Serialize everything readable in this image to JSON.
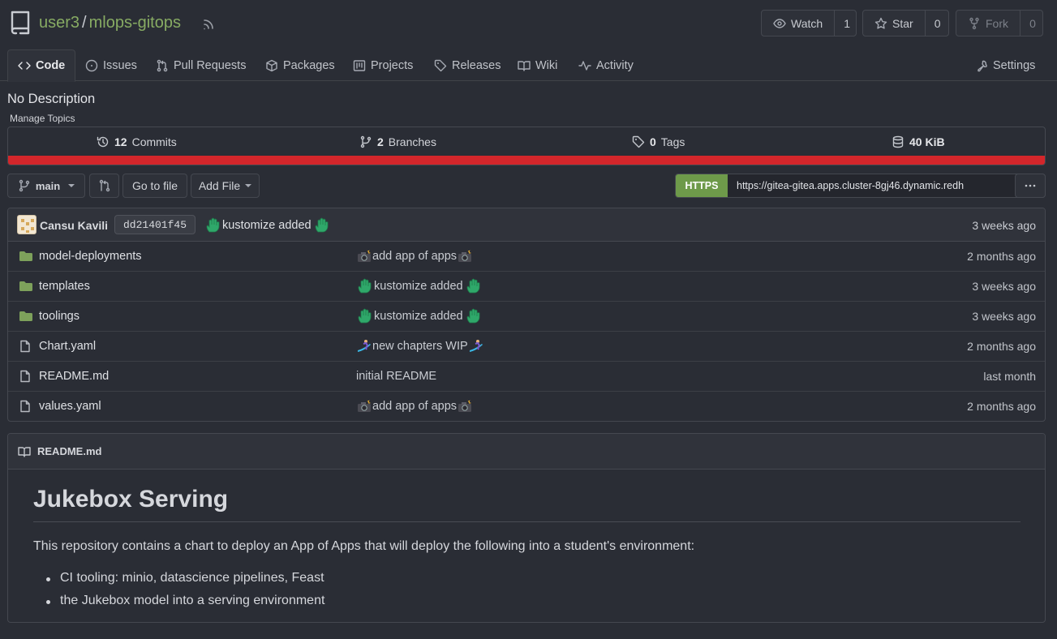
{
  "header": {
    "owner": "user3",
    "separator": "/",
    "repo": "mlops-gitops",
    "watch_label": "Watch",
    "watch_count": "1",
    "star_label": "Star",
    "star_count": "0",
    "fork_label": "Fork",
    "fork_count": "0"
  },
  "tabs": [
    {
      "label": "Code",
      "icon": "code-icon"
    },
    {
      "label": "Issues",
      "icon": "issue-icon"
    },
    {
      "label": "Pull Requests",
      "icon": "pull-request-icon"
    },
    {
      "label": "Packages",
      "icon": "package-icon"
    },
    {
      "label": "Projects",
      "icon": "project-icon"
    },
    {
      "label": "Releases",
      "icon": "tag-icon"
    },
    {
      "label": "Wiki",
      "icon": "book-icon"
    },
    {
      "label": "Activity",
      "icon": "pulse-icon"
    },
    {
      "label": "Settings",
      "icon": "tools-icon"
    }
  ],
  "description": "No Description",
  "manage_topics": "Manage Topics",
  "stats": {
    "commits_count": "12",
    "commits_label": "Commits",
    "branches_count": "2",
    "branches_label": "Branches",
    "tags_count": "0",
    "tags_label": "Tags",
    "size_value": "40 KiB",
    "language_bar_color": "#d3262b"
  },
  "toolbar": {
    "branch": "main",
    "go_to_file": "Go to file",
    "add_file": "Add File",
    "clone_protocol": "HTTPS",
    "clone_url": "https://gitea-gitea.apps.cluster-8gj46.dynamic.redh"
  },
  "latest_commit": {
    "author": "Cansu Kavili",
    "sha": "dd21401f45",
    "message": "kustomize added",
    "time": "3 weeks ago"
  },
  "files": [
    {
      "name": "model-deployments",
      "type": "folder",
      "message": "add app of apps",
      "emoji": "camera",
      "time": "2 months ago"
    },
    {
      "name": "templates",
      "type": "folder",
      "message": "kustomize added",
      "emoji": "hand",
      "time": "3 weeks ago"
    },
    {
      "name": "toolings",
      "type": "folder",
      "message": "kustomize added",
      "emoji": "hand",
      "time": "3 weeks ago"
    },
    {
      "name": "Chart.yaml",
      "type": "file",
      "message": "new chapters WIP",
      "emoji": "surfer",
      "time": "2 months ago"
    },
    {
      "name": "README.md",
      "type": "file",
      "message": "initial README",
      "emoji": "",
      "time": "last month"
    },
    {
      "name": "values.yaml",
      "type": "file",
      "message": "add app of apps",
      "emoji": "camera",
      "time": "2 months ago"
    }
  ],
  "readme": {
    "filename": "README.md",
    "title": "Jukebox Serving",
    "paragraph": "This repository contains a chart to deploy an App of Apps that will deploy the following into a student's environment:",
    "items": [
      "CI tooling: minio, datascience pipelines, Feast",
      "the Jukebox model into a serving environment"
    ]
  },
  "colors": {
    "background": "#2a2d35",
    "accent_green": "#87ab63",
    "https_green": "#6e9a4a",
    "folder_green": "#7da15b"
  }
}
